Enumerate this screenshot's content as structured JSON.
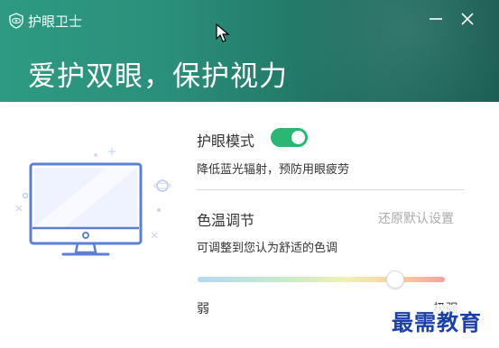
{
  "window": {
    "title": "护眼卫士",
    "minimize_icon": "minimize-icon",
    "close_icon": "close-icon"
  },
  "banner": {
    "slogan": "爱护双眼，保护视力"
  },
  "eye_mode": {
    "label": "护眼模式",
    "enabled": true,
    "description": "降低蓝光辐射，预防用眼疲劳"
  },
  "color_temp": {
    "label": "色温调节",
    "reset_label": "还原默认设置",
    "description": "可调整到您认为舒适的色调",
    "min_label": "弱",
    "max_label": "极强",
    "level_fraction": 0.8
  },
  "watermark": "最需教育",
  "colors": {
    "header_start": "#2e9a82",
    "header_end": "#1a5d52",
    "toggle_on": "#2bb673",
    "illustration_blue": "#5b7fd6"
  }
}
